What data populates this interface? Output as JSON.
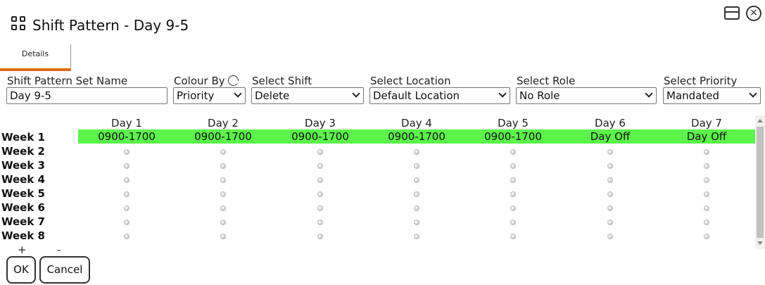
{
  "header": {
    "title": "Shift Pattern - Day 9-5",
    "icons": [
      "apps-grid-icon",
      "maximize-icon",
      "close-icon"
    ],
    "close_glyph": "×"
  },
  "tabs": [
    {
      "label": "Details",
      "active": true
    }
  ],
  "accent_color": "#e06a13",
  "form": {
    "set_name": {
      "label": "Shift Pattern Set Name",
      "value": "Day 9-5"
    },
    "colour_by": {
      "label": "Colour By",
      "value": "Priority"
    },
    "select_shift": {
      "label": "Select Shift",
      "value": "Delete"
    },
    "select_location": {
      "label": "Select Location",
      "value": "Default Location"
    },
    "select_role": {
      "label": "Select Role",
      "value": "No Role"
    },
    "select_priority": {
      "label": "Select Priority",
      "value": "Mandated"
    }
  },
  "grid": {
    "days": [
      "Day 1",
      "Day 2",
      "Day 3",
      "Day 4",
      "Day 5",
      "Day 6",
      "Day 7"
    ],
    "weeks": [
      "Week 1",
      "Week 2",
      "Week 3",
      "Week 4",
      "Week 5",
      "Week 6",
      "Week 7",
      "Week 8"
    ],
    "week1_cells": [
      "0900-1700",
      "0900-1700",
      "0900-1700",
      "0900-1700",
      "0900-1700",
      "Day Off",
      "Day Off"
    ],
    "highlight_color": "#5cf54b",
    "add_week": "+",
    "remove_week": "-"
  },
  "footer": {
    "ok_label": "OK",
    "cancel_label": "Cancel"
  }
}
